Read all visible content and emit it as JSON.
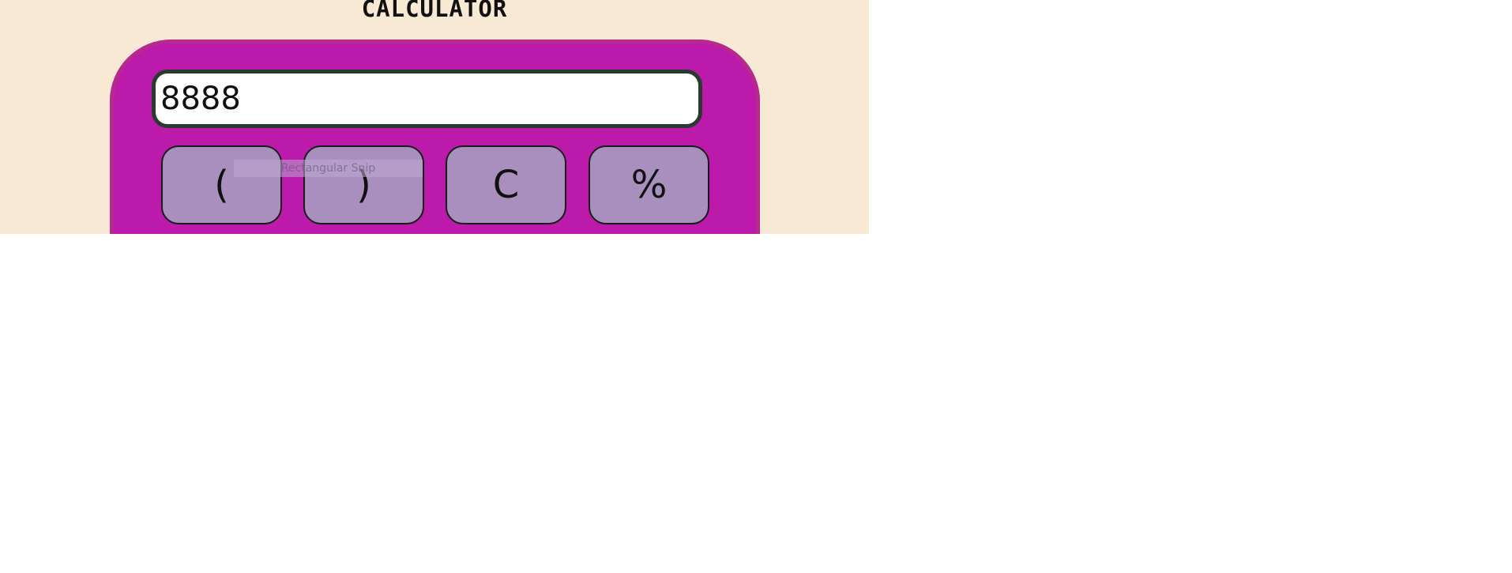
{
  "app": {
    "title": "CALCULATOR"
  },
  "display": {
    "value": "8888"
  },
  "keys": [
    {
      "label": "("
    },
    {
      "label": ")"
    },
    {
      "label": "C"
    },
    {
      "label": "%"
    }
  ],
  "overlay": {
    "tooltip": "Rectangular Snip"
  },
  "colors": {
    "page_background": "#f8e9d4",
    "calculator_body": "#bb1aaa",
    "display_border": "#2b3a2f",
    "key_background": "#a88fbe"
  }
}
